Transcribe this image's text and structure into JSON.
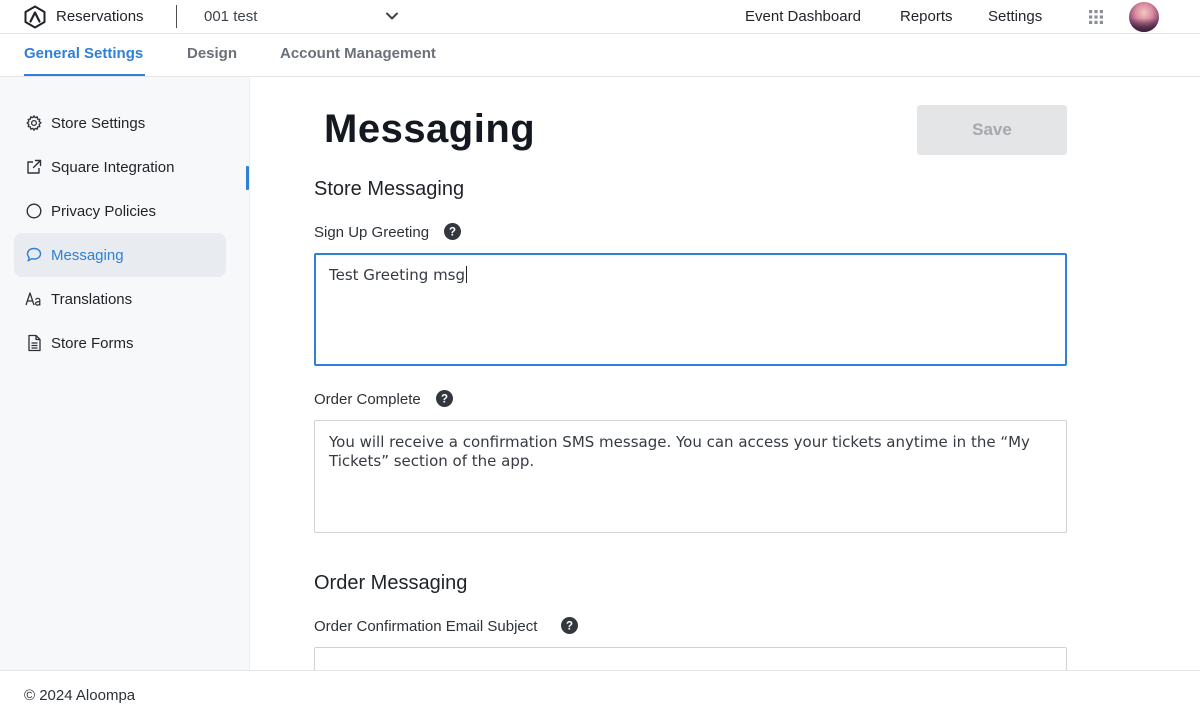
{
  "header": {
    "app_title": "Reservations",
    "store_select_value": "001 test",
    "nav": {
      "event_dashboard": "Event Dashboard",
      "reports": "Reports",
      "settings": "Settings"
    }
  },
  "subtabs": {
    "general": "General Settings",
    "design": "Design",
    "account": "Account Management"
  },
  "sidebar": {
    "items": [
      {
        "label": "Store Settings",
        "icon": "gear-icon"
      },
      {
        "label": "Square Integration",
        "icon": "external-link-icon"
      },
      {
        "label": "Privacy Policies",
        "icon": "circle-icon"
      },
      {
        "label": "Messaging",
        "icon": "chat-bubble-icon",
        "active": true
      },
      {
        "label": "Translations",
        "icon": "font-icon"
      },
      {
        "label": "Store Forms",
        "icon": "document-icon"
      }
    ]
  },
  "main": {
    "title": "Messaging",
    "save_label": "Save",
    "store_messaging": {
      "title": "Store Messaging",
      "sign_up_greeting": {
        "label": "Sign Up Greeting",
        "value": "Test Greeting msg"
      },
      "order_complete": {
        "label": "Order Complete",
        "value": "You will receive a confirmation SMS message. You can access your tickets anytime in the “My Tickets” section of the app."
      }
    },
    "order_messaging": {
      "title": "Order Messaging",
      "email_subject": {
        "label": "Order Confirmation Email Subject"
      }
    }
  },
  "footer": {
    "copyright": "© 2024 Aloompa"
  },
  "colors": {
    "accent": "#2f80d8",
    "sidebar_bg": "#f7f8fa",
    "save_disabled_bg": "#e4e5e7"
  }
}
